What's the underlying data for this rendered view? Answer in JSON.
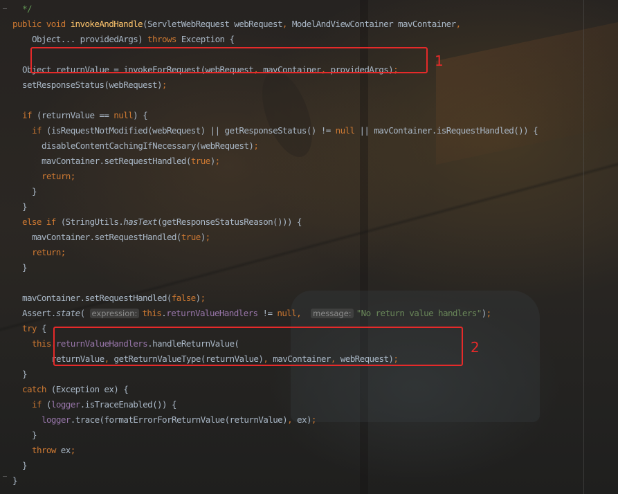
{
  "editor": {
    "colors": {
      "background": "#2b2723",
      "keyword": "#cc7832",
      "method_declaration": "#ffc66d",
      "field": "#9876aa",
      "string": "#6a8759",
      "plain": "#a9b7c6",
      "comment": "#629755",
      "annotation_box": "#e62a2a"
    },
    "code_lines": [
      {
        "indent": 4,
        "tokens": [
          {
            "t": "*/",
            "c": "cmt"
          }
        ]
      },
      {
        "indent": 2,
        "tokens": [
          {
            "t": "public ",
            "c": "kw"
          },
          {
            "t": "void ",
            "c": "kw"
          },
          {
            "t": "invokeAndHandle",
            "c": "fn"
          },
          {
            "t": "(ServletWebRequest webRequest",
            "c": "plain"
          },
          {
            "t": ", ",
            "c": "kw"
          },
          {
            "t": "ModelAndViewContainer mavContainer",
            "c": "plain"
          },
          {
            "t": ",",
            "c": "kw"
          }
        ]
      },
      {
        "indent": 6,
        "tokens": [
          {
            "t": "Object... providedArgs) ",
            "c": "plain"
          },
          {
            "t": "throws ",
            "c": "kw"
          },
          {
            "t": "Exception {",
            "c": "plain"
          }
        ]
      },
      {
        "indent": 0,
        "tokens": []
      },
      {
        "indent": 4,
        "tokens": [
          {
            "t": "Object returnValue = invokeForRequest(webRequest",
            "c": "plain"
          },
          {
            "t": ", ",
            "c": "kw"
          },
          {
            "t": "mavContainer",
            "c": "plain"
          },
          {
            "t": ", ",
            "c": "kw"
          },
          {
            "t": "providedArgs)",
            "c": "plain"
          },
          {
            "t": ";",
            "c": "kw"
          }
        ]
      },
      {
        "indent": 4,
        "tokens": [
          {
            "t": "setResponseStatus(webRequest)",
            "c": "plain"
          },
          {
            "t": ";",
            "c": "kw"
          }
        ]
      },
      {
        "indent": 0,
        "tokens": []
      },
      {
        "indent": 4,
        "tokens": [
          {
            "t": "if ",
            "c": "kw"
          },
          {
            "t": "(returnValue == ",
            "c": "plain"
          },
          {
            "t": "null",
            "c": "kw"
          },
          {
            "t": ") {",
            "c": "plain"
          }
        ]
      },
      {
        "indent": 6,
        "tokens": [
          {
            "t": "if ",
            "c": "kw"
          },
          {
            "t": "(isRequestNotModified(webRequest) || getResponseStatus() != ",
            "c": "plain"
          },
          {
            "t": "null ",
            "c": "kw"
          },
          {
            "t": "|| mavContainer.isRequestHandled()) {",
            "c": "plain"
          }
        ]
      },
      {
        "indent": 8,
        "tokens": [
          {
            "t": "disableContentCachingIfNecessary(webRequest)",
            "c": "plain"
          },
          {
            "t": ";",
            "c": "kw"
          }
        ]
      },
      {
        "indent": 8,
        "tokens": [
          {
            "t": "mavContainer.setRequestHandled(",
            "c": "plain"
          },
          {
            "t": "true",
            "c": "kw"
          },
          {
            "t": ")",
            "c": "plain"
          },
          {
            "t": ";",
            "c": "kw"
          }
        ]
      },
      {
        "indent": 8,
        "tokens": [
          {
            "t": "return;",
            "c": "kw"
          }
        ]
      },
      {
        "indent": 6,
        "tokens": [
          {
            "t": "}",
            "c": "plain"
          }
        ]
      },
      {
        "indent": 4,
        "tokens": [
          {
            "t": "}",
            "c": "plain"
          }
        ]
      },
      {
        "indent": 4,
        "tokens": [
          {
            "t": "else if ",
            "c": "kw"
          },
          {
            "t": "(StringUtils.",
            "c": "plain"
          },
          {
            "t": "hasText",
            "c": "plain",
            "italic": true
          },
          {
            "t": "(getResponseStatusReason())) {",
            "c": "plain"
          }
        ]
      },
      {
        "indent": 6,
        "tokens": [
          {
            "t": "mavContainer.setRequestHandled(",
            "c": "plain"
          },
          {
            "t": "true",
            "c": "kw"
          },
          {
            "t": ")",
            "c": "plain"
          },
          {
            "t": ";",
            "c": "kw"
          }
        ]
      },
      {
        "indent": 6,
        "tokens": [
          {
            "t": "return;",
            "c": "kw"
          }
        ]
      },
      {
        "indent": 4,
        "tokens": [
          {
            "t": "}",
            "c": "plain"
          }
        ]
      },
      {
        "indent": 0,
        "tokens": []
      },
      {
        "indent": 4,
        "tokens": [
          {
            "t": "mavContainer.setRequestHandled(",
            "c": "plain"
          },
          {
            "t": "false",
            "c": "kw"
          },
          {
            "t": ")",
            "c": "plain"
          },
          {
            "t": ";",
            "c": "kw"
          }
        ]
      },
      {
        "indent": 4,
        "tokens": [
          {
            "t": "Assert.",
            "c": "plain"
          },
          {
            "t": "state",
            "c": "plain",
            "italic": true
          },
          {
            "t": "( ",
            "c": "plain"
          },
          {
            "t": "expression:",
            "c": "hint"
          },
          {
            "t": "this",
            "c": "kw"
          },
          {
            "t": ".",
            "c": "plain"
          },
          {
            "t": "returnValueHandlers ",
            "c": "field"
          },
          {
            "t": "!= ",
            "c": "plain"
          },
          {
            "t": "null",
            "c": "kw"
          },
          {
            "t": ",  ",
            "c": "kw"
          },
          {
            "t": "message:",
            "c": "hint"
          },
          {
            "t": "\"No return value handlers\"",
            "c": "str"
          },
          {
            "t": ")",
            "c": "plain"
          },
          {
            "t": ";",
            "c": "kw"
          }
        ]
      },
      {
        "indent": 4,
        "tokens": [
          {
            "t": "try ",
            "c": "kw"
          },
          {
            "t": "{",
            "c": "plain"
          }
        ]
      },
      {
        "indent": 6,
        "tokens": [
          {
            "t": "this",
            "c": "kw"
          },
          {
            "t": ".",
            "c": "plain"
          },
          {
            "t": "returnValueHandlers",
            "c": "field"
          },
          {
            "t": ".handleReturnValue(",
            "c": "plain"
          }
        ]
      },
      {
        "indent": 10,
        "tokens": [
          {
            "t": "returnValue",
            "c": "plain"
          },
          {
            "t": ", ",
            "c": "kw"
          },
          {
            "t": "getReturnValueType(returnValue)",
            "c": "plain"
          },
          {
            "t": ", ",
            "c": "kw"
          },
          {
            "t": "mavContainer",
            "c": "plain"
          },
          {
            "t": ", ",
            "c": "kw"
          },
          {
            "t": "webRequest)",
            "c": "plain"
          },
          {
            "t": ";",
            "c": "kw"
          }
        ]
      },
      {
        "indent": 4,
        "tokens": [
          {
            "t": "}",
            "c": "plain"
          }
        ]
      },
      {
        "indent": 4,
        "tokens": [
          {
            "t": "catch ",
            "c": "kw"
          },
          {
            "t": "(Exception ex) {",
            "c": "plain"
          }
        ]
      },
      {
        "indent": 6,
        "tokens": [
          {
            "t": "if ",
            "c": "kw"
          },
          {
            "t": "(",
            "c": "plain"
          },
          {
            "t": "logger",
            "c": "field"
          },
          {
            "t": ".isTraceEnabled()) {",
            "c": "plain"
          }
        ]
      },
      {
        "indent": 8,
        "tokens": [
          {
            "t": "logger",
            "c": "field"
          },
          {
            "t": ".trace(formatErrorForReturnValue(returnValue)",
            "c": "plain"
          },
          {
            "t": ", ",
            "c": "kw"
          },
          {
            "t": "ex)",
            "c": "plain"
          },
          {
            "t": ";",
            "c": "kw"
          }
        ]
      },
      {
        "indent": 6,
        "tokens": [
          {
            "t": "}",
            "c": "plain"
          }
        ]
      },
      {
        "indent": 6,
        "tokens": [
          {
            "t": "throw ",
            "c": "kw"
          },
          {
            "t": "ex",
            "c": "plain"
          },
          {
            "t": ";",
            "c": "kw"
          }
        ]
      },
      {
        "indent": 4,
        "tokens": [
          {
            "t": "}",
            "c": "plain"
          }
        ]
      },
      {
        "indent": 2,
        "tokens": [
          {
            "t": "}",
            "c": "plain"
          }
        ]
      }
    ]
  },
  "annotations": {
    "box_1_label": "1",
    "box_2_label": "2"
  }
}
